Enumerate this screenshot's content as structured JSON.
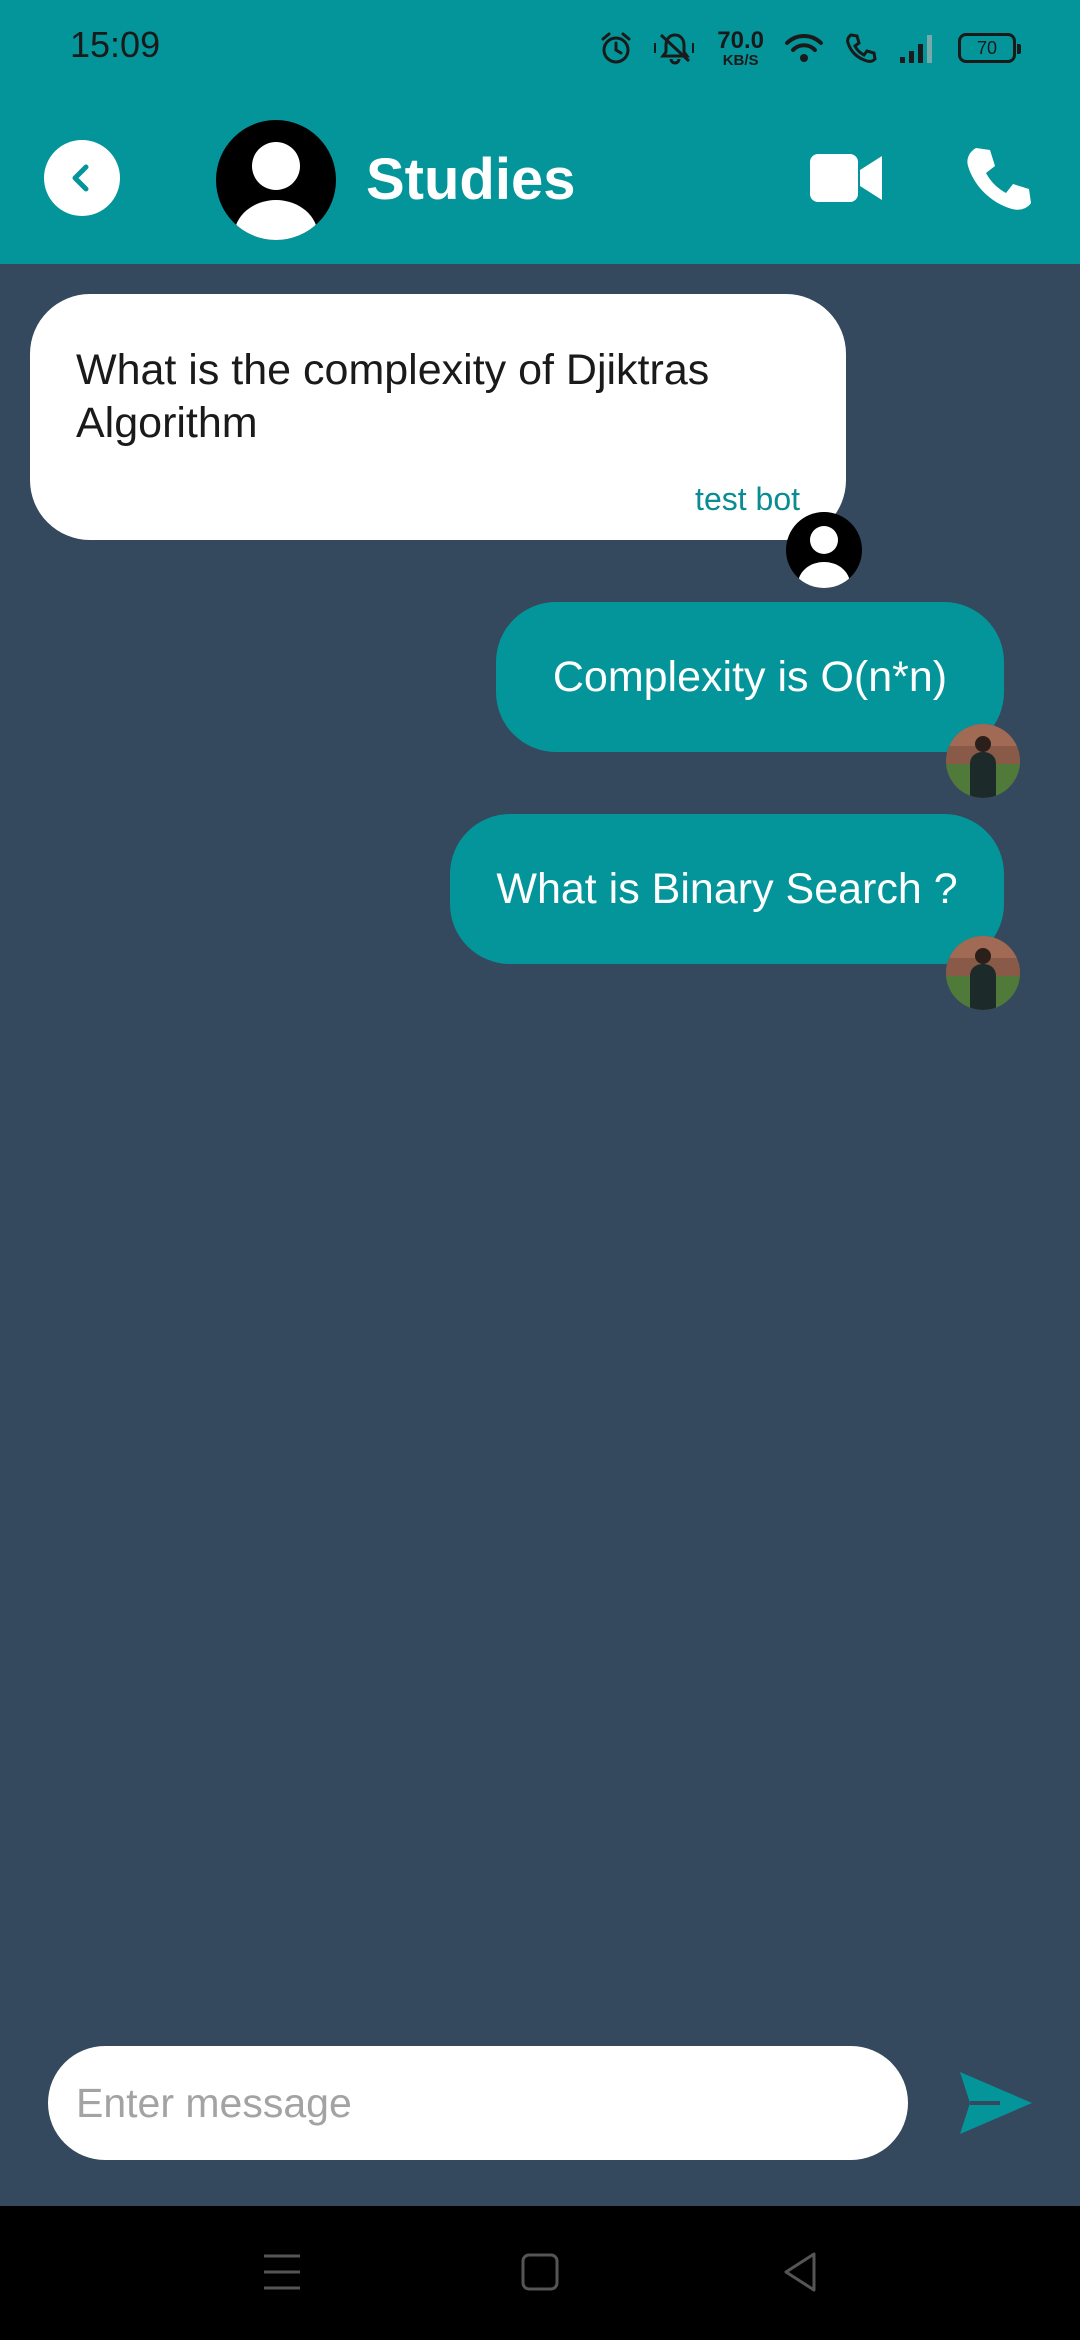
{
  "status_bar": {
    "time": "15:09",
    "net_speed_value": "70.0",
    "net_speed_unit": "KB/S",
    "battery_level": "70"
  },
  "header": {
    "title": "Studies",
    "back_icon": "chevron-left-icon",
    "video_icon": "video-camera-icon",
    "call_icon": "phone-icon"
  },
  "messages": [
    {
      "direction": "incoming",
      "text": "What is the complexity of Djiktras Algorithm",
      "sender": "test bot"
    },
    {
      "direction": "outgoing",
      "text": "Complexity is O(n*n)"
    },
    {
      "direction": "outgoing",
      "text": "What is Binary Search ?"
    }
  ],
  "composer": {
    "placeholder": "Enter message",
    "value": "",
    "send_icon": "send-icon"
  },
  "colors": {
    "primary": "#04959a",
    "chat_background": "#34495e",
    "incoming_bubble": "#ffffff",
    "sender_label": "#0a8d92"
  },
  "nav_bar": {
    "menu_icon": "menu-icon",
    "home_icon": "home-square-icon",
    "back_icon": "back-triangle-icon"
  }
}
